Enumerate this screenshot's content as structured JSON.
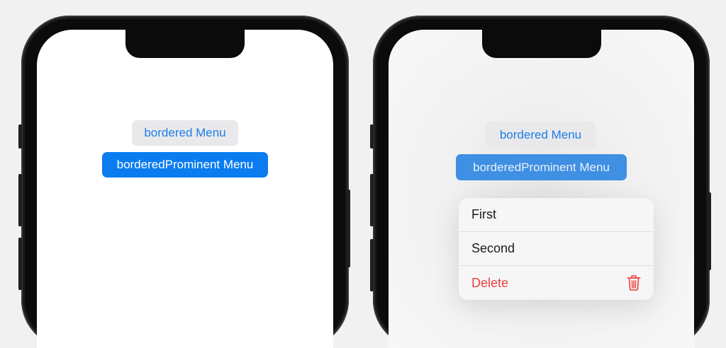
{
  "left_screen": {
    "bordered_menu_label": "bordered Menu",
    "prominent_menu_label": "borderedProminent Menu"
  },
  "right_screen": {
    "bordered_menu_label": "bordered Menu",
    "prominent_menu_label": "borderedProminent Menu",
    "menu": {
      "items": [
        {
          "label": "First"
        },
        {
          "label": "Second"
        },
        {
          "label": "Delete",
          "icon": "trash-icon",
          "role": "destructive"
        }
      ]
    }
  },
  "colors": {
    "accent": "#0a7cf0",
    "bordered_bg": "#e9e9eb",
    "destructive": "#ea3f3a"
  }
}
